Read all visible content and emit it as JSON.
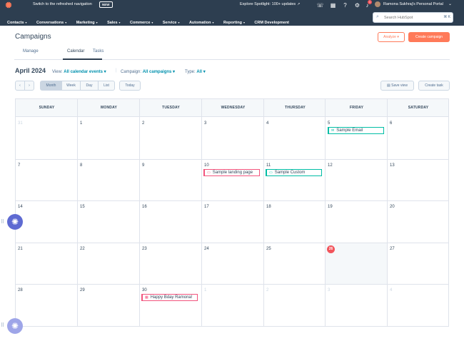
{
  "topbar": {
    "switch_nav": "Switch to the refreshed navigation",
    "new_badge": "NEW",
    "spotlight": "Explore Spotlight: 100+ updates",
    "notif_count": "1",
    "portal_name": "Ramona Sukhraj's Personal Portal",
    "search_placeholder": "Search HubSpot",
    "search_keys": "⌘ K"
  },
  "nav": [
    "Contacts",
    "Conversations",
    "Marketing",
    "Sales",
    "Commerce",
    "Service",
    "Automation",
    "Reporting",
    "CRM Development"
  ],
  "page": {
    "title": "Campaigns",
    "analyze": "Analyze",
    "create": "Create campaign",
    "tabs": [
      "Manage",
      "Calendar",
      "Tasks"
    ]
  },
  "toolbar": {
    "month": "April 2024",
    "view_label": "View:",
    "view_value": "All calendar events",
    "campaign_label": "Campaign:",
    "campaign_value": "All campaigns",
    "type_label": "Type:",
    "type_value": "All",
    "prev": "‹",
    "next": "›",
    "modes": [
      "Month",
      "Week",
      "Day",
      "List"
    ],
    "today": "Today",
    "save_view": "Save view",
    "create_task": "Create task"
  },
  "calendar": {
    "daynames": [
      "SUNDAY",
      "MONDAY",
      "TUESDAY",
      "WEDNESDAY",
      "THURSDAY",
      "FRIDAY",
      "SATURDAY"
    ],
    "weeks": [
      [
        "31",
        "1",
        "2",
        "3",
        "4",
        "5",
        "6"
      ],
      [
        "7",
        "8",
        "9",
        "10",
        "11",
        "12",
        "13"
      ],
      [
        "14",
        "15",
        "16",
        "17",
        "18",
        "19",
        "20"
      ],
      [
        "21",
        "22",
        "23",
        "24",
        "25",
        "26",
        "27"
      ],
      [
        "28",
        "29",
        "30",
        "1",
        "2",
        "3",
        "4"
      ]
    ],
    "today": "26",
    "events": {
      "sample_email": "Sample Email",
      "sample_landing": "Sample landing page",
      "sample_custom": "Sample Custom",
      "bday": "Happy Bday Ramona!"
    }
  },
  "colors": {
    "nav_bg": "#2d3e50",
    "accent": "#ff7a59",
    "link": "#0091ae",
    "today": "#f2545b"
  }
}
